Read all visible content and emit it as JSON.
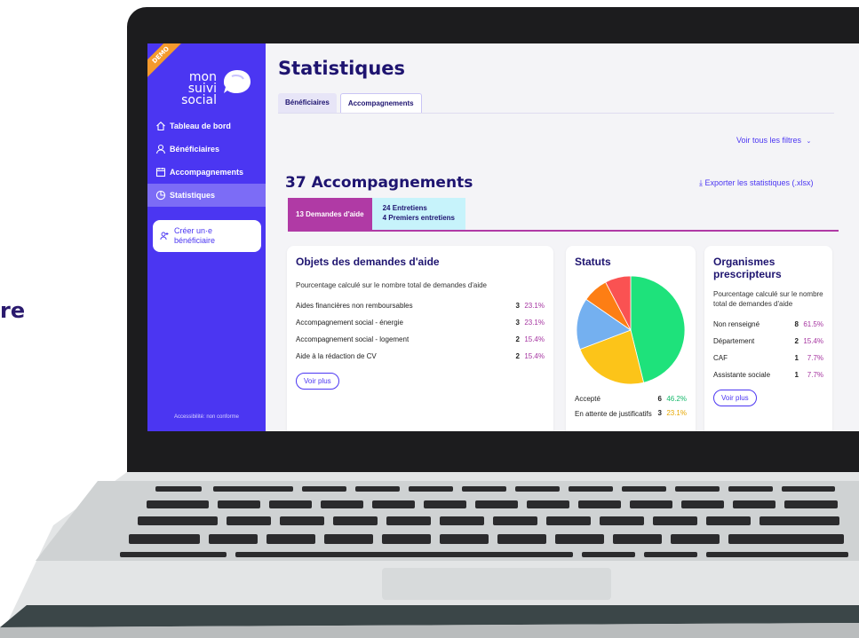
{
  "background_text": "re",
  "app": {
    "demo_badge": "DEMO",
    "logo_line1": "mon suivi",
    "logo_line2": "social",
    "create_button": "Créer un·e bénéficiaire",
    "accessibility": "Accessibilité: non conforme"
  },
  "nav": [
    {
      "label": "Tableau de bord",
      "icon": "home-icon"
    },
    {
      "label": "Bénéficiaires",
      "icon": "user-icon"
    },
    {
      "label": "Accompagnements",
      "icon": "calendar-icon"
    },
    {
      "label": "Statistiques",
      "icon": "chart-pie-icon"
    }
  ],
  "page": {
    "title": "Statistiques",
    "tabs": [
      "Bénéficiaires",
      "Accompagnements"
    ],
    "filters_link": "Voir tous les filtres",
    "section_title": "37 Accompagnements",
    "export_link": "Exporter les statistiques (.xlsx)",
    "subtab_active": "13 Demandes d'aide",
    "subtab_other_1": "24 Entretiens",
    "subtab_other_2": "4 Premiers entretiens"
  },
  "card_objets": {
    "title": "Objets des demandes d'aide",
    "desc": "Pourcentage calculé sur le nombre total de demandes d'aide",
    "rows": [
      {
        "label": "Aides financières non remboursables",
        "count": "3",
        "pct": "23.1%"
      },
      {
        "label": "Accompagnement social - énergie",
        "count": "3",
        "pct": "23.1%"
      },
      {
        "label": "Accompagnement social - logement",
        "count": "2",
        "pct": "15.4%"
      },
      {
        "label": "Aide à la rédaction de CV",
        "count": "2",
        "pct": "15.4%"
      }
    ],
    "more": "Voir plus"
  },
  "card_statuts": {
    "title": "Statuts",
    "rows": [
      {
        "label": "Accepté",
        "count": "6",
        "pct": "46.2%"
      },
      {
        "label": "En attente de justificatifs",
        "count": "3",
        "pct": "23.1%"
      }
    ]
  },
  "card_orgs": {
    "title": "Organismes prescripteurs",
    "desc": "Pourcentage calculé sur le nombre total de demandes d'aide",
    "rows": [
      {
        "label": "Non renseigné",
        "count": "8",
        "pct": "61.5%"
      },
      {
        "label": "Département",
        "count": "2",
        "pct": "15.4%"
      },
      {
        "label": "CAF",
        "count": "1",
        "pct": "7.7%"
      },
      {
        "label": "Assistante sociale",
        "count": "1",
        "pct": "7.7%"
      }
    ],
    "more": "Voir plus"
  },
  "chart_data": {
    "type": "pie",
    "values": [
      46.2,
      23.1,
      15.4,
      7.7,
      7.7
    ],
    "colors": [
      "#1ee27b",
      "#fcc419",
      "#74b0f0",
      "#fd7e14",
      "#fa5252"
    ]
  },
  "colors": {
    "accent": "#4b36f2",
    "pink": "#b03aa5",
    "green": "#1ee27b",
    "amber": "#fcc419"
  }
}
